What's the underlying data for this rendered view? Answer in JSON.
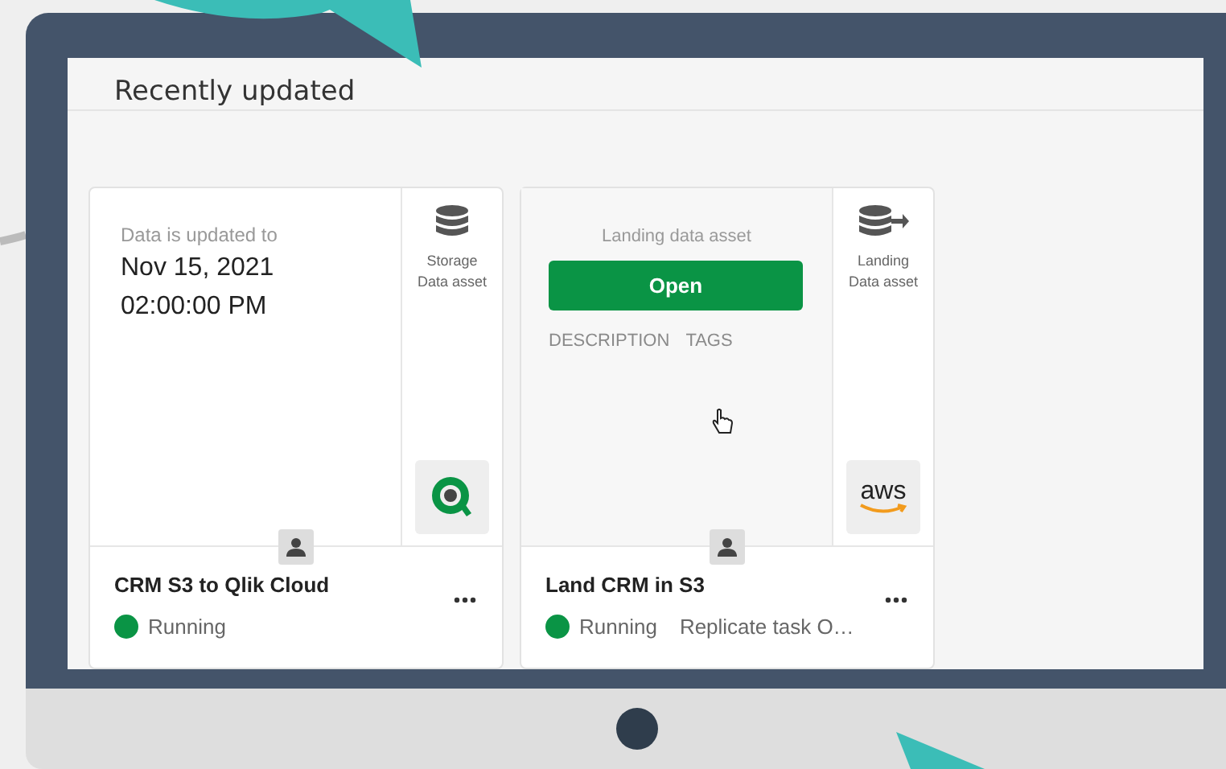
{
  "screen": {
    "title": "Recently updated"
  },
  "cards": [
    {
      "kind": "updated",
      "label": "Data is updated to",
      "date": "Nov 15, 2021",
      "time": "02:00:00 PM",
      "asset": {
        "kind": "storage",
        "type": "Storage Data asset"
      },
      "logo": {
        "kind": "qlik"
      },
      "name": "CRM S3 to Qlik Cloud",
      "status": "Running"
    },
    {
      "kind": "hover",
      "heading": "Landing data asset",
      "button": "Open",
      "links": [
        "DESCRIPTION",
        "TAGS"
      ],
      "asset": {
        "kind": "landing",
        "type": "Landing Data asset"
      },
      "logo": {
        "kind": "aws",
        "text": "aws"
      },
      "name": "Land CRM in S3",
      "status": "Running",
      "detail": "Replicate task O…"
    }
  ]
}
